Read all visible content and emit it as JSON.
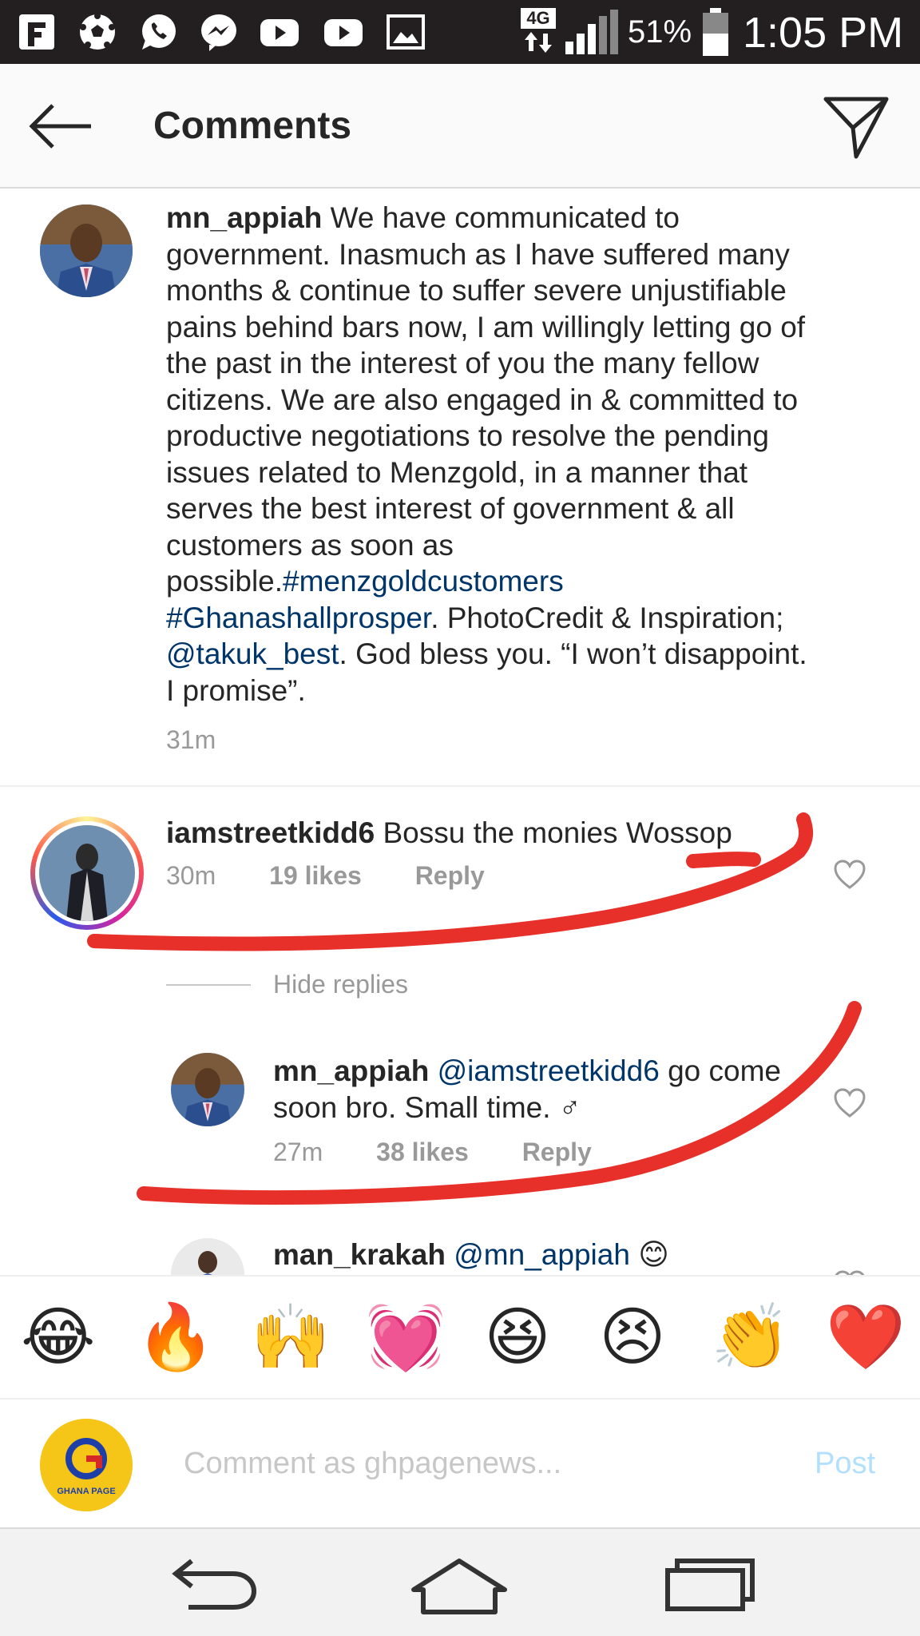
{
  "status_bar": {
    "icons": [
      "flipboard-icon",
      "soccer-ball-icon",
      "whatsapp-icon",
      "messenger-icon",
      "youtube-icon",
      "youtube-icon",
      "gallery-icon"
    ],
    "network": "4G",
    "battery": "51%",
    "time": "1:05 PM"
  },
  "header": {
    "title": "Comments",
    "back_icon": "arrow-left-icon",
    "share_icon": "paper-plane-icon"
  },
  "caption": {
    "username": "mn_appiah",
    "text_lines": [
      "We have communicated to",
      "government. Inasmuch as I have suffered many",
      "months & continue to suffer severe unjustifiable",
      "pains behind bars now, I am willingly letting go of",
      "the past in the interest of you the many fellow",
      "citizens. We are also engaged in & committed to",
      "productive negotiations to resolve the pending",
      "issues related to Menzgold, in a manner that",
      "serves the best interest of government & all",
      "customers as soon as"
    ],
    "possible": "possible.",
    "hashtag1": "#menzgoldcustomers",
    "hashtag2": "#Ghanashallprosper",
    "after_hashtag2": ". PhotoCredit & Inspiration;",
    "mention": "@takuk_best",
    "after_mention": ". God bless you. “I won’t disappoint.",
    "last_line": "I promise”.",
    "time": "31m"
  },
  "comments": [
    {
      "username": "iamstreetkidd6",
      "text": "Bossu the monies Wossop",
      "time": "30m",
      "likes": "19 likes",
      "reply": "Reply",
      "hide_replies": "Hide replies"
    },
    {
      "username": "mn_appiah",
      "mention": "@iamstreetkidd6",
      "text_line1": "go come",
      "text_line2": "soon bro. Small time. ♂",
      "time": "27m",
      "likes": "38 likes",
      "reply": "Reply"
    },
    {
      "username": "man_krakah",
      "mention": "@mn_appiah",
      "emoji": "😊"
    }
  ],
  "emoji_bar": [
    "😂",
    "🔥",
    "🙌",
    "💓",
    "😆",
    "😣",
    "👏",
    "❤️"
  ],
  "composer": {
    "placeholder": "Comment as ghpagenews...",
    "post_label": "Post",
    "avatar_text": "GHANA PAGE"
  },
  "nav_bar": {
    "icons": [
      "back-nav-icon",
      "home-nav-icon",
      "recents-nav-icon"
    ]
  },
  "colors": {
    "status_bar_bg": "#231f20",
    "header_bg": "#fafafa",
    "link": "#003569",
    "meta": "#999999",
    "annotation_red": "#e8302a",
    "post_button": "#b2dffc"
  }
}
